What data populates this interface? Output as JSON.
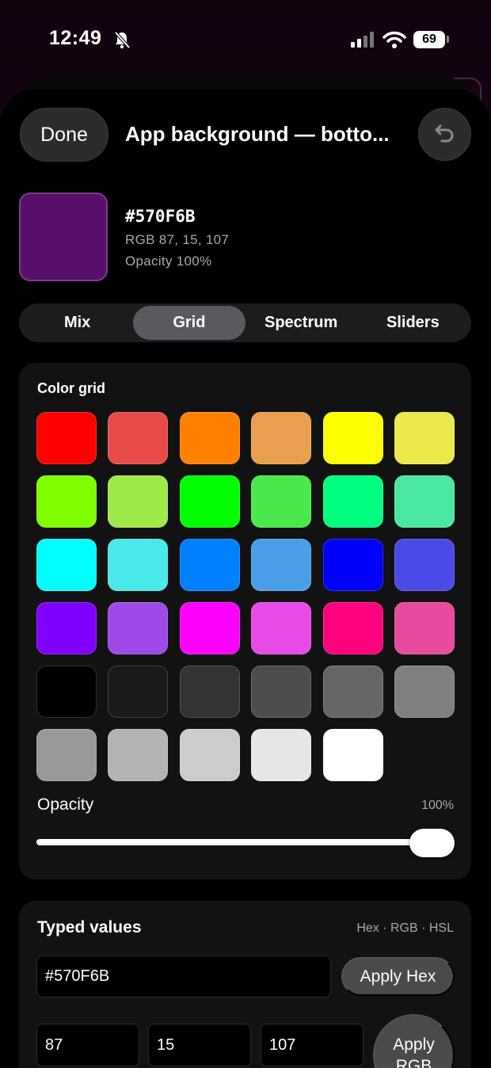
{
  "status_bar": {
    "time": "12:49",
    "battery": "69"
  },
  "header": {
    "done_label": "Done",
    "title": "App background — botto..."
  },
  "current_color": {
    "hex": "#570F6B",
    "rgb_text": "RGB 87, 15, 107",
    "opacity_text": "Opacity 100%",
    "swatch": "#570F6B"
  },
  "tabs": [
    {
      "label": "Mix"
    },
    {
      "label": "Grid",
      "active": true
    },
    {
      "label": "Spectrum"
    },
    {
      "label": "Sliders"
    }
  ],
  "color_grid": {
    "label": "Color grid",
    "colors": [
      "#FF0000",
      "#E84A4A",
      "#FF7F00",
      "#E99F4F",
      "#FFFF00",
      "#EBE94B",
      "#7FFF00",
      "#9EE84A",
      "#00FF00",
      "#4BE84B",
      "#00FF7F",
      "#4AE89E",
      "#00FFFF",
      "#4AE8E8",
      "#007FFF",
      "#4A9EE8",
      "#0000FF",
      "#4A4AE8",
      "#7F00FF",
      "#9E4AE8",
      "#FF00FF",
      "#E84AE8",
      "#FF007F",
      "#E84A9E",
      "#000000",
      "#1A1A1A",
      "#333333",
      "#4D4D4D",
      "#666666",
      "#808080",
      "#999999",
      "#B3B3B3",
      "#CCCCCC",
      "#E6E6E6",
      "#FFFFFF"
    ]
  },
  "opacity": {
    "label": "Opacity",
    "value_text": "100%",
    "value": 1.0
  },
  "typed_values": {
    "title": "Typed values",
    "hint": "Hex · RGB · HSL",
    "hex_value": "#570F6B",
    "apply_hex_label": "Apply Hex",
    "r": "87",
    "g": "15",
    "b": "107",
    "apply_rgb_label": "Apply RGB"
  }
}
